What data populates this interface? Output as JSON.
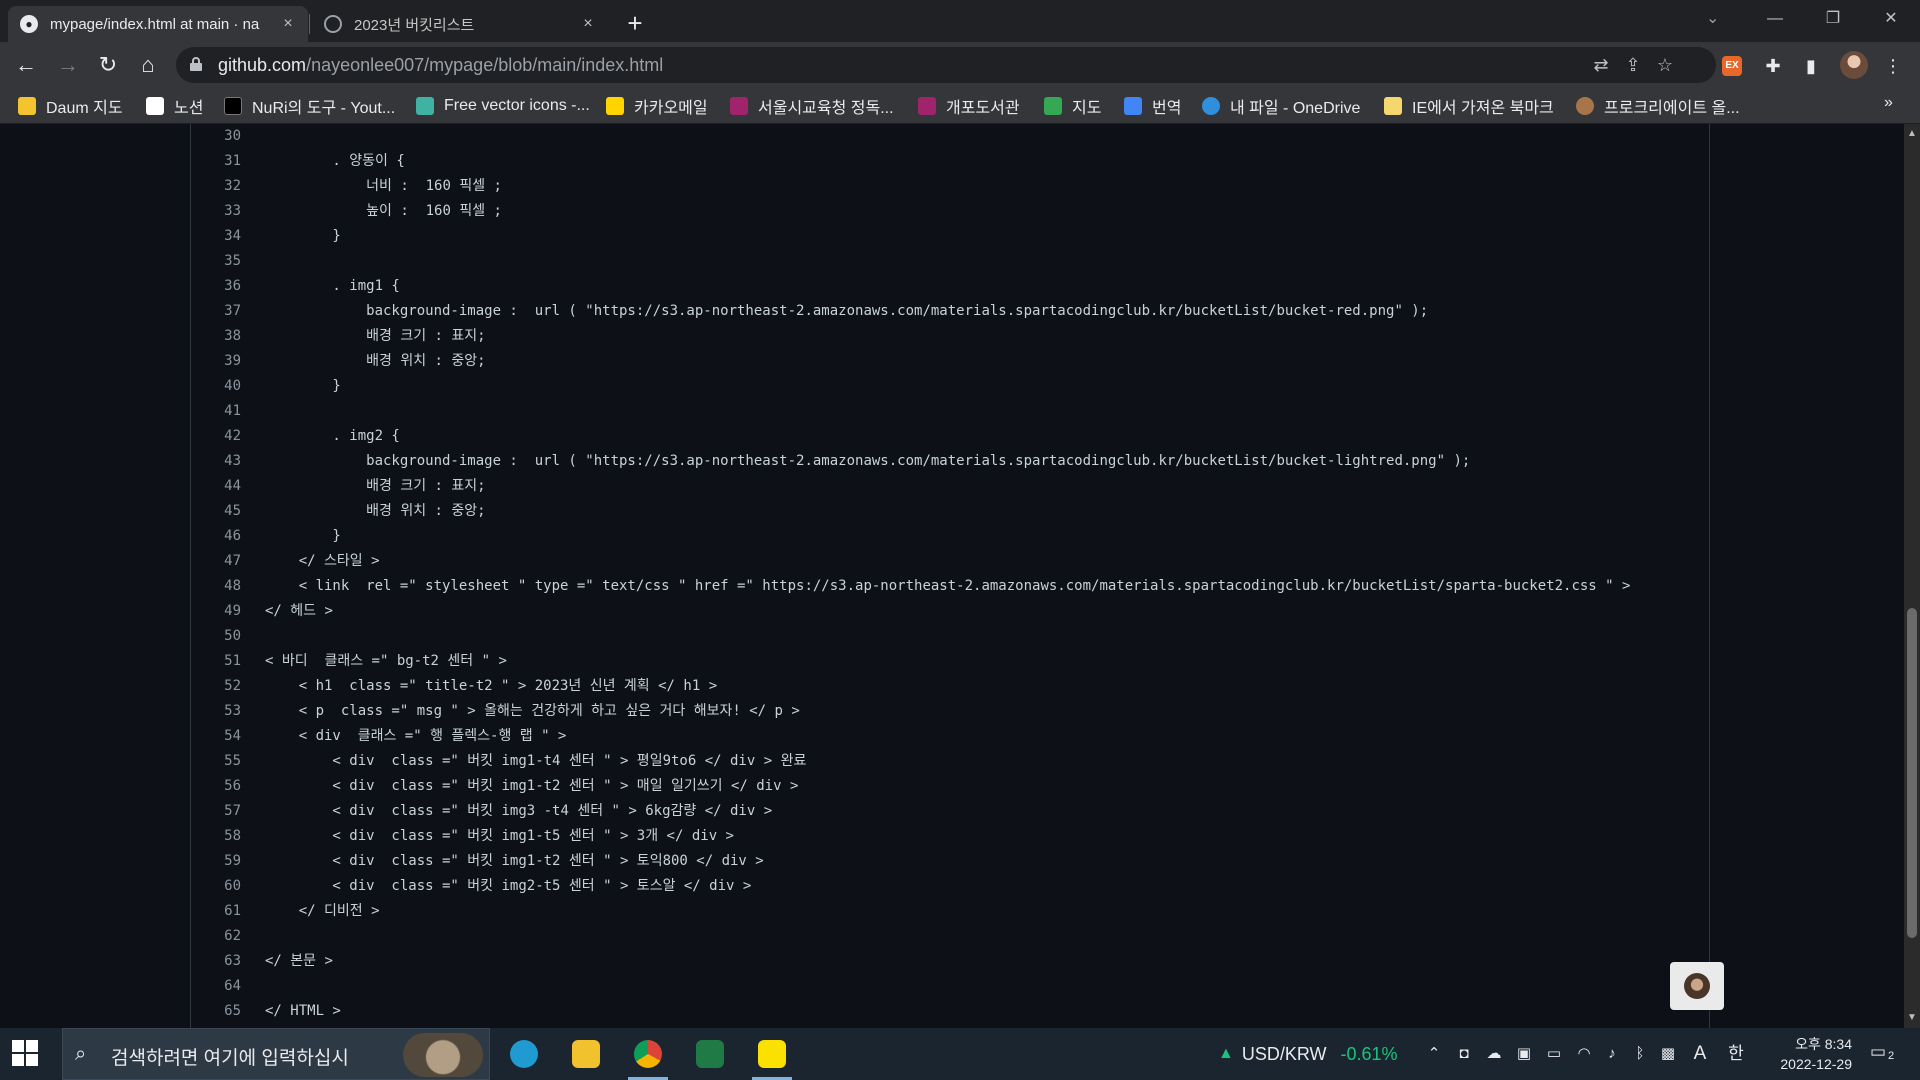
{
  "browser": {
    "tabs": [
      {
        "title": "mypage/index.html at main · na",
        "active": true,
        "favicon": "github-icon"
      },
      {
        "title": "2023년 버킷리스트",
        "active": false,
        "favicon": "globe-icon"
      }
    ],
    "close_glyph": "×",
    "new_tab_glyph": "+",
    "address": {
      "host": "github.com",
      "path": "/nayeonlee007/mypage/blob/main/index.html"
    },
    "bookmarks": [
      {
        "label": "Daum 지도",
        "icon": "map-pin-icon",
        "color": "#f4c430"
      },
      {
        "label": "노션",
        "icon": "notion-icon",
        "color": "#ffffff"
      },
      {
        "label": "NuRi의 도구 - Yout...",
        "icon": "tools-icon",
        "color": "#000000"
      },
      {
        "label": "Free vector icons -...",
        "icon": "flaticon-icon",
        "color": "#3fb2a3"
      },
      {
        "label": "카카오메일",
        "icon": "kakaomail-icon",
        "color": "#ffd400"
      },
      {
        "label": "서울시교육청 정독...",
        "icon": "library-icon",
        "color": "#a0246b"
      },
      {
        "label": "개포도서관",
        "icon": "library-icon",
        "color": "#a0246b"
      },
      {
        "label": "지도",
        "icon": "google-maps-icon",
        "color": "#34a853"
      },
      {
        "label": "번역",
        "icon": "google-translate-icon",
        "color": "#4285f4"
      },
      {
        "label": "내 파일 - OneDrive",
        "icon": "onedrive-icon",
        "color": "#2f8fdd"
      },
      {
        "label": "IE에서 가져온 북마크",
        "icon": "folder-icon",
        "color": "#f5d76e"
      },
      {
        "label": "프로크리에이트 올...",
        "icon": "procreate-icon",
        "color": "#a8754b"
      }
    ],
    "bookmarks_overflow": "»"
  },
  "code": {
    "lines": [
      {
        "n": "30",
        "text": ""
      },
      {
        "n": "31",
        "text": "        . 양동이 {"
      },
      {
        "n": "32",
        "text": "            너비 :  160 픽셀 ;"
      },
      {
        "n": "33",
        "text": "            높이 :  160 픽셀 ;"
      },
      {
        "n": "34",
        "text": "        }"
      },
      {
        "n": "35",
        "text": ""
      },
      {
        "n": "36",
        "text": "        . img1 {"
      },
      {
        "n": "37",
        "text": "            background-image :  url ( \"https://s3.ap-northeast-2.amazonaws.com/materials.spartacodingclub.kr/bucketList/bucket-red.png\" );"
      },
      {
        "n": "38",
        "text": "            배경 크기 : 표지;"
      },
      {
        "n": "39",
        "text": "            배경 위치 : 중앙;"
      },
      {
        "n": "40",
        "text": "        }"
      },
      {
        "n": "41",
        "text": ""
      },
      {
        "n": "42",
        "text": "        . img2 {"
      },
      {
        "n": "43",
        "text": "            background-image :  url ( \"https://s3.ap-northeast-2.amazonaws.com/materials.spartacodingclub.kr/bucketList/bucket-lightred.png\" );"
      },
      {
        "n": "44",
        "text": "            배경 크기 : 표지;"
      },
      {
        "n": "45",
        "text": "            배경 위치 : 중앙;"
      },
      {
        "n": "46",
        "text": "        }"
      },
      {
        "n": "47",
        "text": "    </ 스타일 >"
      },
      {
        "n": "48",
        "text": "    < link  rel =\" stylesheet \" type =\" text/css \" href =\" https://s3.ap-northeast-2.amazonaws.com/materials.spartacodingclub.kr/bucketList/sparta-bucket2.css \" >"
      },
      {
        "n": "49",
        "text": "</ 헤드 >"
      },
      {
        "n": "50",
        "text": ""
      },
      {
        "n": "51",
        "text": "< 바디  클래스 =\" bg-t2 센터 \" >"
      },
      {
        "n": "52",
        "text": "    < h1  class =\" title-t2 \" > 2023년 신년 계획 </ h1 >"
      },
      {
        "n": "53",
        "text": "    < p  class =\" msg \" > 올해는 건강하게 하고 싶은 거다 해보자! </ p >"
      },
      {
        "n": "54",
        "text": "    < div  클래스 =\" 행 플렉스-행 랩 \" >"
      },
      {
        "n": "55",
        "text": "        < div  class =\" 버킷 img1-t4 센터 \" > 평일9to6 </ div > 완료"
      },
      {
        "n": "56",
        "text": "        < div  class =\" 버킷 img1-t2 센터 \" > 매일 일기쓰기 </ div >"
      },
      {
        "n": "57",
        "text": "        < div  class =\" 버킷 img3 -t4 센터 \" > 6kg감량 </ div >"
      },
      {
        "n": "58",
        "text": "        < div  class =\" 버킷 img1-t5 센터 \" > 3개 </ div >"
      },
      {
        "n": "59",
        "text": "        < div  class =\" 버킷 img1-t2 센터 \" > 토익800 </ div >"
      },
      {
        "n": "60",
        "text": "        < div  class =\" 버킷 img2-t5 센터 \" > 토스알 </ div >"
      },
      {
        "n": "61",
        "text": "    </ 디비전 >"
      },
      {
        "n": "62",
        "text": ""
      },
      {
        "n": "63",
        "text": "</ 본문 >"
      },
      {
        "n": "64",
        "text": ""
      },
      {
        "n": "65",
        "text": "</ HTML >"
      }
    ]
  },
  "taskbar": {
    "search_placeholder": "검색하려면 여기에 입력하십시",
    "apps": [
      {
        "name": "edge",
        "color": "#1f9bd1"
      },
      {
        "name": "file-explorer",
        "color": "#f2c12e"
      },
      {
        "name": "chrome",
        "color": "#db4437"
      },
      {
        "name": "excel",
        "color": "#1f7a46"
      },
      {
        "name": "kakaotalk",
        "color": "#fae100"
      }
    ],
    "ticker": {
      "symbol": "USD/KRW",
      "change": "-0.61%"
    },
    "ime_mode": "A",
    "ime_lang": "한",
    "clock": {
      "time": "오후 8:34",
      "date": "2022-12-29"
    },
    "notification_count": "2"
  },
  "colors": {
    "page_bg": "#0d1117",
    "code_text": "#c9d1d9",
    "line_number": "#8b949e",
    "ticker_green": "#19c37d"
  }
}
